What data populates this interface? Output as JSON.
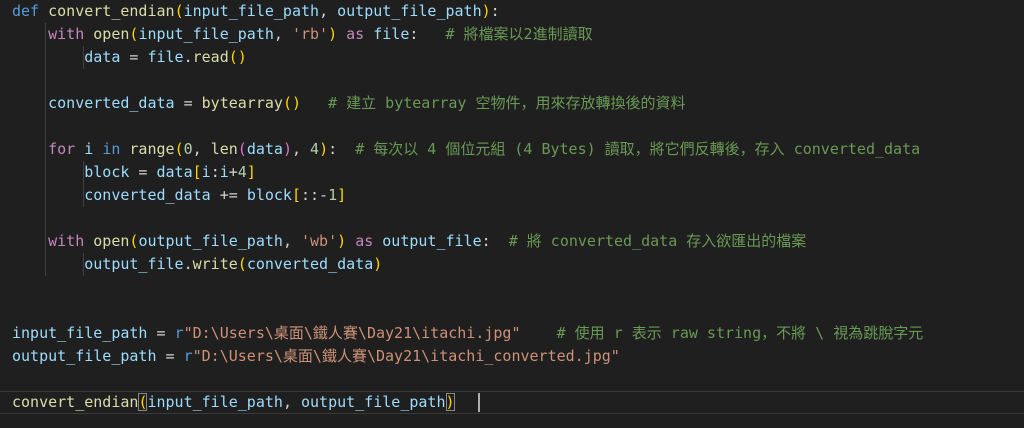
{
  "editor": {
    "language": "python",
    "theme_colors": {
      "background": "#1f1f1f",
      "keyword": "#569cd6",
      "control": "#c586c0",
      "function": "#dcdcaa",
      "variable": "#9cdcfe",
      "string": "#ce9178",
      "number": "#b5cea8",
      "comment": "#6a9955",
      "bracket_level_1": "#ffd700",
      "bracket_level_2": "#da70d6",
      "bracket_level_3": "#179fff"
    },
    "lines": [
      {
        "tokens": [
          {
            "t": "kw",
            "v": "def"
          },
          {
            "t": "op",
            "v": " "
          },
          {
            "t": "fn",
            "v": "convert_endian"
          },
          {
            "t": "p1",
            "v": "("
          },
          {
            "t": "var",
            "v": "input_file_path"
          },
          {
            "t": "op",
            "v": ", "
          },
          {
            "t": "var",
            "v": "output_file_path"
          },
          {
            "t": "p1",
            "v": ")"
          },
          {
            "t": "op",
            "v": ":"
          }
        ]
      },
      {
        "tokens": [
          {
            "t": "op",
            "v": "    "
          },
          {
            "t": "ctl",
            "v": "with"
          },
          {
            "t": "op",
            "v": " "
          },
          {
            "t": "fn",
            "v": "open"
          },
          {
            "t": "p1",
            "v": "("
          },
          {
            "t": "var",
            "v": "input_file_path"
          },
          {
            "t": "op",
            "v": ", "
          },
          {
            "t": "str",
            "v": "'rb'"
          },
          {
            "t": "p1",
            "v": ")"
          },
          {
            "t": "op",
            "v": " "
          },
          {
            "t": "ctl",
            "v": "as"
          },
          {
            "t": "op",
            "v": " "
          },
          {
            "t": "var",
            "v": "file"
          },
          {
            "t": "op",
            "v": ":   "
          },
          {
            "t": "com",
            "v": "# 將檔案以2進制讀取"
          }
        ]
      },
      {
        "tokens": [
          {
            "t": "op",
            "v": "        "
          },
          {
            "t": "var",
            "v": "data"
          },
          {
            "t": "op",
            "v": " = "
          },
          {
            "t": "var",
            "v": "file"
          },
          {
            "t": "op",
            "v": "."
          },
          {
            "t": "fn",
            "v": "read"
          },
          {
            "t": "p1",
            "v": "()"
          }
        ]
      },
      {
        "tokens": []
      },
      {
        "tokens": [
          {
            "t": "op",
            "v": "    "
          },
          {
            "t": "var",
            "v": "converted_data"
          },
          {
            "t": "op",
            "v": " = "
          },
          {
            "t": "fn",
            "v": "bytearray"
          },
          {
            "t": "p1",
            "v": "()"
          },
          {
            "t": "op",
            "v": "   "
          },
          {
            "t": "com",
            "v": "# 建立 bytearray 空物件，用來存放轉換後的資料"
          }
        ]
      },
      {
        "tokens": []
      },
      {
        "tokens": [
          {
            "t": "op",
            "v": "    "
          },
          {
            "t": "ctl",
            "v": "for"
          },
          {
            "t": "op",
            "v": " "
          },
          {
            "t": "var",
            "v": "i"
          },
          {
            "t": "op",
            "v": " "
          },
          {
            "t": "kw",
            "v": "in"
          },
          {
            "t": "op",
            "v": " "
          },
          {
            "t": "fn",
            "v": "range"
          },
          {
            "t": "p1",
            "v": "("
          },
          {
            "t": "num",
            "v": "0"
          },
          {
            "t": "op",
            "v": ", "
          },
          {
            "t": "fn",
            "v": "len"
          },
          {
            "t": "p2",
            "v": "("
          },
          {
            "t": "var",
            "v": "data"
          },
          {
            "t": "p2",
            "v": ")"
          },
          {
            "t": "op",
            "v": ", "
          },
          {
            "t": "num",
            "v": "4"
          },
          {
            "t": "p1",
            "v": ")"
          },
          {
            "t": "op",
            "v": ":  "
          },
          {
            "t": "com",
            "v": "# 每次以 4 個位元組 (4 Bytes) 讀取，將它們反轉後，存入 converted_data"
          }
        ]
      },
      {
        "tokens": [
          {
            "t": "op",
            "v": "        "
          },
          {
            "t": "var",
            "v": "block"
          },
          {
            "t": "op",
            "v": " = "
          },
          {
            "t": "var",
            "v": "data"
          },
          {
            "t": "p1",
            "v": "["
          },
          {
            "t": "var",
            "v": "i"
          },
          {
            "t": "op",
            "v": ":"
          },
          {
            "t": "var",
            "v": "i"
          },
          {
            "t": "op",
            "v": "+"
          },
          {
            "t": "num",
            "v": "4"
          },
          {
            "t": "p1",
            "v": "]"
          }
        ]
      },
      {
        "tokens": [
          {
            "t": "op",
            "v": "        "
          },
          {
            "t": "var",
            "v": "converted_data"
          },
          {
            "t": "op",
            "v": " += "
          },
          {
            "t": "var",
            "v": "block"
          },
          {
            "t": "p1",
            "v": "["
          },
          {
            "t": "op",
            "v": "::-"
          },
          {
            "t": "num",
            "v": "1"
          },
          {
            "t": "p1",
            "v": "]"
          }
        ]
      },
      {
        "tokens": []
      },
      {
        "tokens": [
          {
            "t": "op",
            "v": "    "
          },
          {
            "t": "ctl",
            "v": "with"
          },
          {
            "t": "op",
            "v": " "
          },
          {
            "t": "fn",
            "v": "open"
          },
          {
            "t": "p1",
            "v": "("
          },
          {
            "t": "var",
            "v": "output_file_path"
          },
          {
            "t": "op",
            "v": ", "
          },
          {
            "t": "str",
            "v": "'wb'"
          },
          {
            "t": "p1",
            "v": ")"
          },
          {
            "t": "op",
            "v": " "
          },
          {
            "t": "ctl",
            "v": "as"
          },
          {
            "t": "op",
            "v": " "
          },
          {
            "t": "var",
            "v": "output_file"
          },
          {
            "t": "op",
            "v": ":  "
          },
          {
            "t": "com",
            "v": "# 將 converted_data 存入欲匯出的檔案"
          }
        ]
      },
      {
        "tokens": [
          {
            "t": "op",
            "v": "        "
          },
          {
            "t": "var",
            "v": "output_file"
          },
          {
            "t": "op",
            "v": "."
          },
          {
            "t": "fn",
            "v": "write"
          },
          {
            "t": "p1",
            "v": "("
          },
          {
            "t": "var",
            "v": "converted_data"
          },
          {
            "t": "p1",
            "v": ")"
          }
        ]
      },
      {
        "tokens": []
      },
      {
        "tokens": []
      },
      {
        "tokens": [
          {
            "t": "var",
            "v": "input_file_path"
          },
          {
            "t": "op",
            "v": " = "
          },
          {
            "t": "kw",
            "v": "r"
          },
          {
            "t": "str",
            "v": "\"D:\\Users\\桌面\\鐵人賽\\Day21\\itachi.jpg\""
          },
          {
            "t": "op",
            "v": "    "
          },
          {
            "t": "com",
            "v": "# 使用 r 表示 raw string，不將 \\ 視為跳脫字元"
          }
        ]
      },
      {
        "tokens": [
          {
            "t": "var",
            "v": "output_file_path"
          },
          {
            "t": "op",
            "v": " = "
          },
          {
            "t": "kw",
            "v": "r"
          },
          {
            "t": "str",
            "v": "\"D:\\Users\\桌面\\鐵人賽\\Day21\\itachi_converted.jpg\""
          }
        ]
      },
      {
        "tokens": []
      },
      {
        "current": true,
        "tokens": [
          {
            "t": "fn",
            "v": "convert_endian"
          },
          {
            "t": "pm",
            "v": "("
          },
          {
            "t": "var",
            "v": "input_file_path"
          },
          {
            "t": "op",
            "v": ", "
          },
          {
            "t": "var",
            "v": "output_file_path"
          },
          {
            "t": "pm",
            "v": ")"
          }
        ]
      }
    ]
  }
}
